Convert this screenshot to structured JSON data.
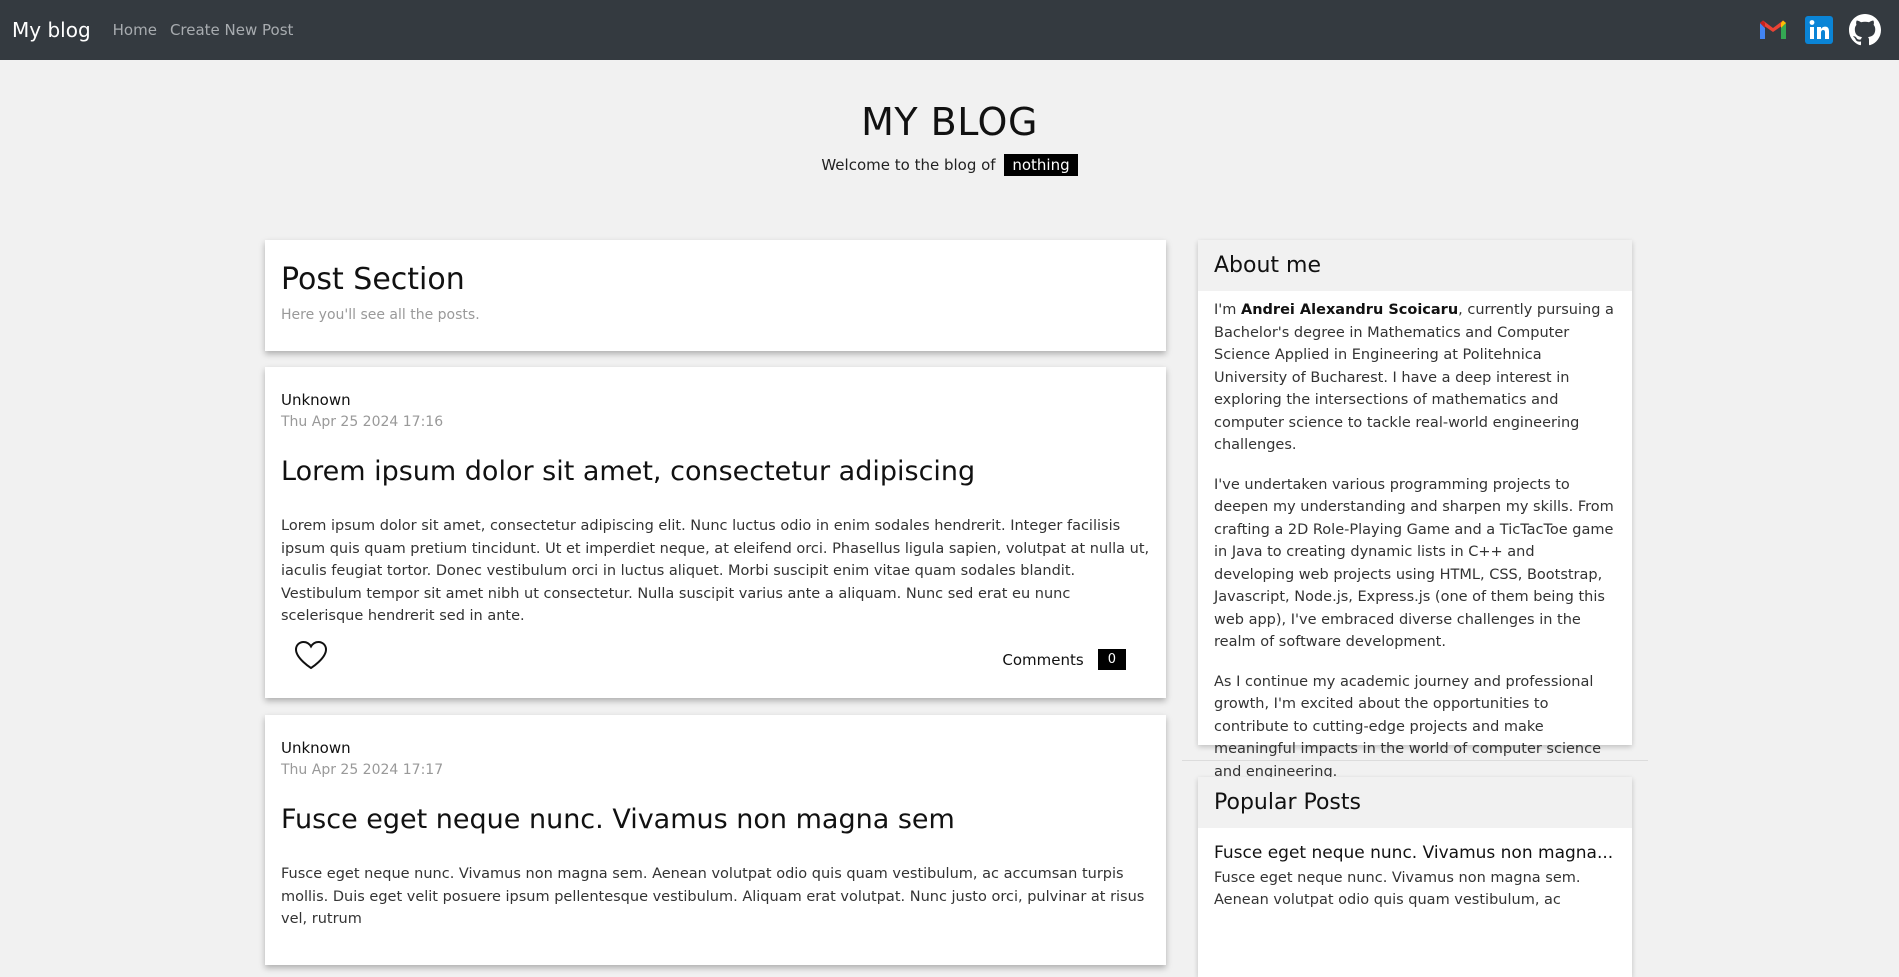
{
  "navbar": {
    "brand": "My blog",
    "links": [
      "Home",
      "Create New Post"
    ],
    "icons": [
      "gmail-icon",
      "linkedin-icon",
      "github-icon"
    ]
  },
  "header": {
    "title": "MY BLOG",
    "subtitle": "Welcome to the blog of",
    "subtitle_badge": "nothing"
  },
  "post_section": {
    "title": "Post Section",
    "description": "Here you'll see all the posts."
  },
  "posts": [
    {
      "author": "Unknown",
      "date": "Thu Apr 25 2024 17:16",
      "title": "Lorem ipsum dolor sit amet, consectetur adipiscing",
      "body": "Lorem ipsum dolor sit amet, consectetur adipiscing elit. Nunc luctus odio in enim sodales hendrerit. Integer facilisis ipsum quis quam pretium tincidunt. Ut et imperdiet neque, at eleifend orci. Phasellus ligula sapien, volutpat at nulla ut, iaculis feugiat tortor. Donec vestibulum orci in luctus aliquet. Morbi suscipit enim vitae quam sodales blandit. Vestibulum tempor sit amet nibh ut consectetur. Nulla suscipit varius ante a aliquam. Nunc sed erat eu nunc scelerisque hendrerit sed in ante.",
      "comments_label": "Comments",
      "comments_count": "0"
    },
    {
      "author": "Unknown",
      "date": "Thu Apr 25 2024 17:17",
      "title": "Fusce eget neque nunc. Vivamus non magna sem",
      "body": "Fusce eget neque nunc. Vivamus non magna sem. Aenean volutpat odio quis quam vestibulum, ac accumsan turpis mollis. Duis eget velit posuere ipsum pellentesque vestibulum. Aliquam erat volutpat. Nunc justo orci, pulvinar at risus vel, rutrum"
    }
  ],
  "about": {
    "title": "About me",
    "p1_prefix": "I'm ",
    "p1_name": "Andrei Alexandru Scoicaru",
    "p1_rest": ", currently pursuing a Bachelor's degree in Mathematics and Computer Science Applied in Engineering at Politehnica University of Bucharest. I have a deep interest in exploring the intersections of mathematics and computer science to tackle real-world engineering challenges.",
    "p2": "I've undertaken various programming projects to deepen my understanding and sharpen my skills. From crafting a 2D Role-Playing Game and a TicTacToe game in Java to creating dynamic lists in C++ and developing web projects using HTML, CSS, Bootstrap, Javascript, Node.js, Express.js (one of them being this web app), I've embraced diverse challenges in the realm of software development.",
    "p3": "As I continue my academic journey and professional growth, I'm excited about the opportunities to contribute to cutting-edge projects and make meaningful impacts in the world of computer science and engineering."
  },
  "popular": {
    "title": "Popular Posts",
    "post_title": "Fusce eget neque nunc. Vivamus non magna...",
    "post_excerpt": "Fusce eget neque nunc. Vivamus non magna sem. Aenean volutpat odio quis quam vestibulum, ac"
  },
  "colors": {
    "navbar_bg": "#343a40",
    "page_bg": "#f1f1f1",
    "badge_bg": "#000000"
  }
}
